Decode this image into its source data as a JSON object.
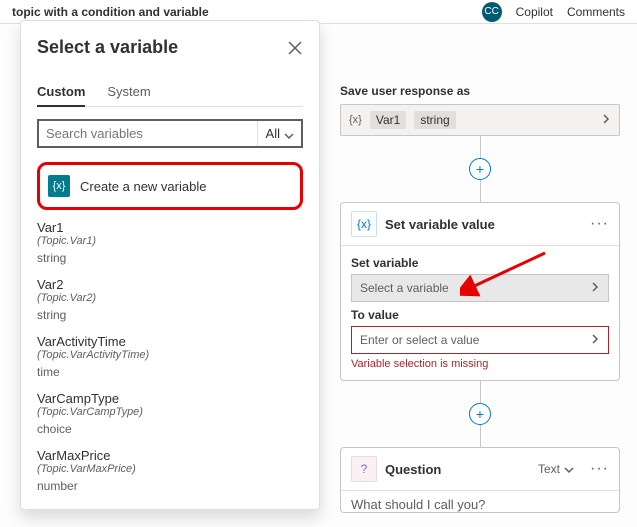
{
  "topBar": {
    "title": "topic with a condition and variable",
    "copilot": "Copilot",
    "comments": "Comments"
  },
  "panel": {
    "title": "Select a variable",
    "tabs": {
      "custom": "Custom",
      "system": "System"
    },
    "searchPlaceholder": "Search variables",
    "filterAll": "All",
    "createNew": "Create a new variable",
    "vars": [
      {
        "name": "Var1",
        "path": "(Topic.Var1)",
        "type": "string"
      },
      {
        "name": "Var2",
        "path": "(Topic.Var2)",
        "type": "string"
      },
      {
        "name": "VarActivityTime",
        "path": "(Topic.VarActivityTime)",
        "type": "time"
      },
      {
        "name": "VarCampType",
        "path": "(Topic.VarCampType)",
        "type": "choice"
      },
      {
        "name": "VarMaxPrice",
        "path": "(Topic.VarMaxPrice)",
        "type": "number"
      }
    ]
  },
  "canvas": {
    "saveLabel": "Save user response as",
    "saveVar": "Var1",
    "saveType": "string",
    "setCard": {
      "title": "Set variable value",
      "setLabel": "Set variable",
      "setPlaceholder": "Select a variable",
      "toLabel": "To value",
      "toPlaceholder": "Enter or select a value",
      "error": "Variable selection is missing"
    },
    "qCard": {
      "title": "Question",
      "textOption": "Text",
      "prompt": "What should I call you?"
    }
  }
}
